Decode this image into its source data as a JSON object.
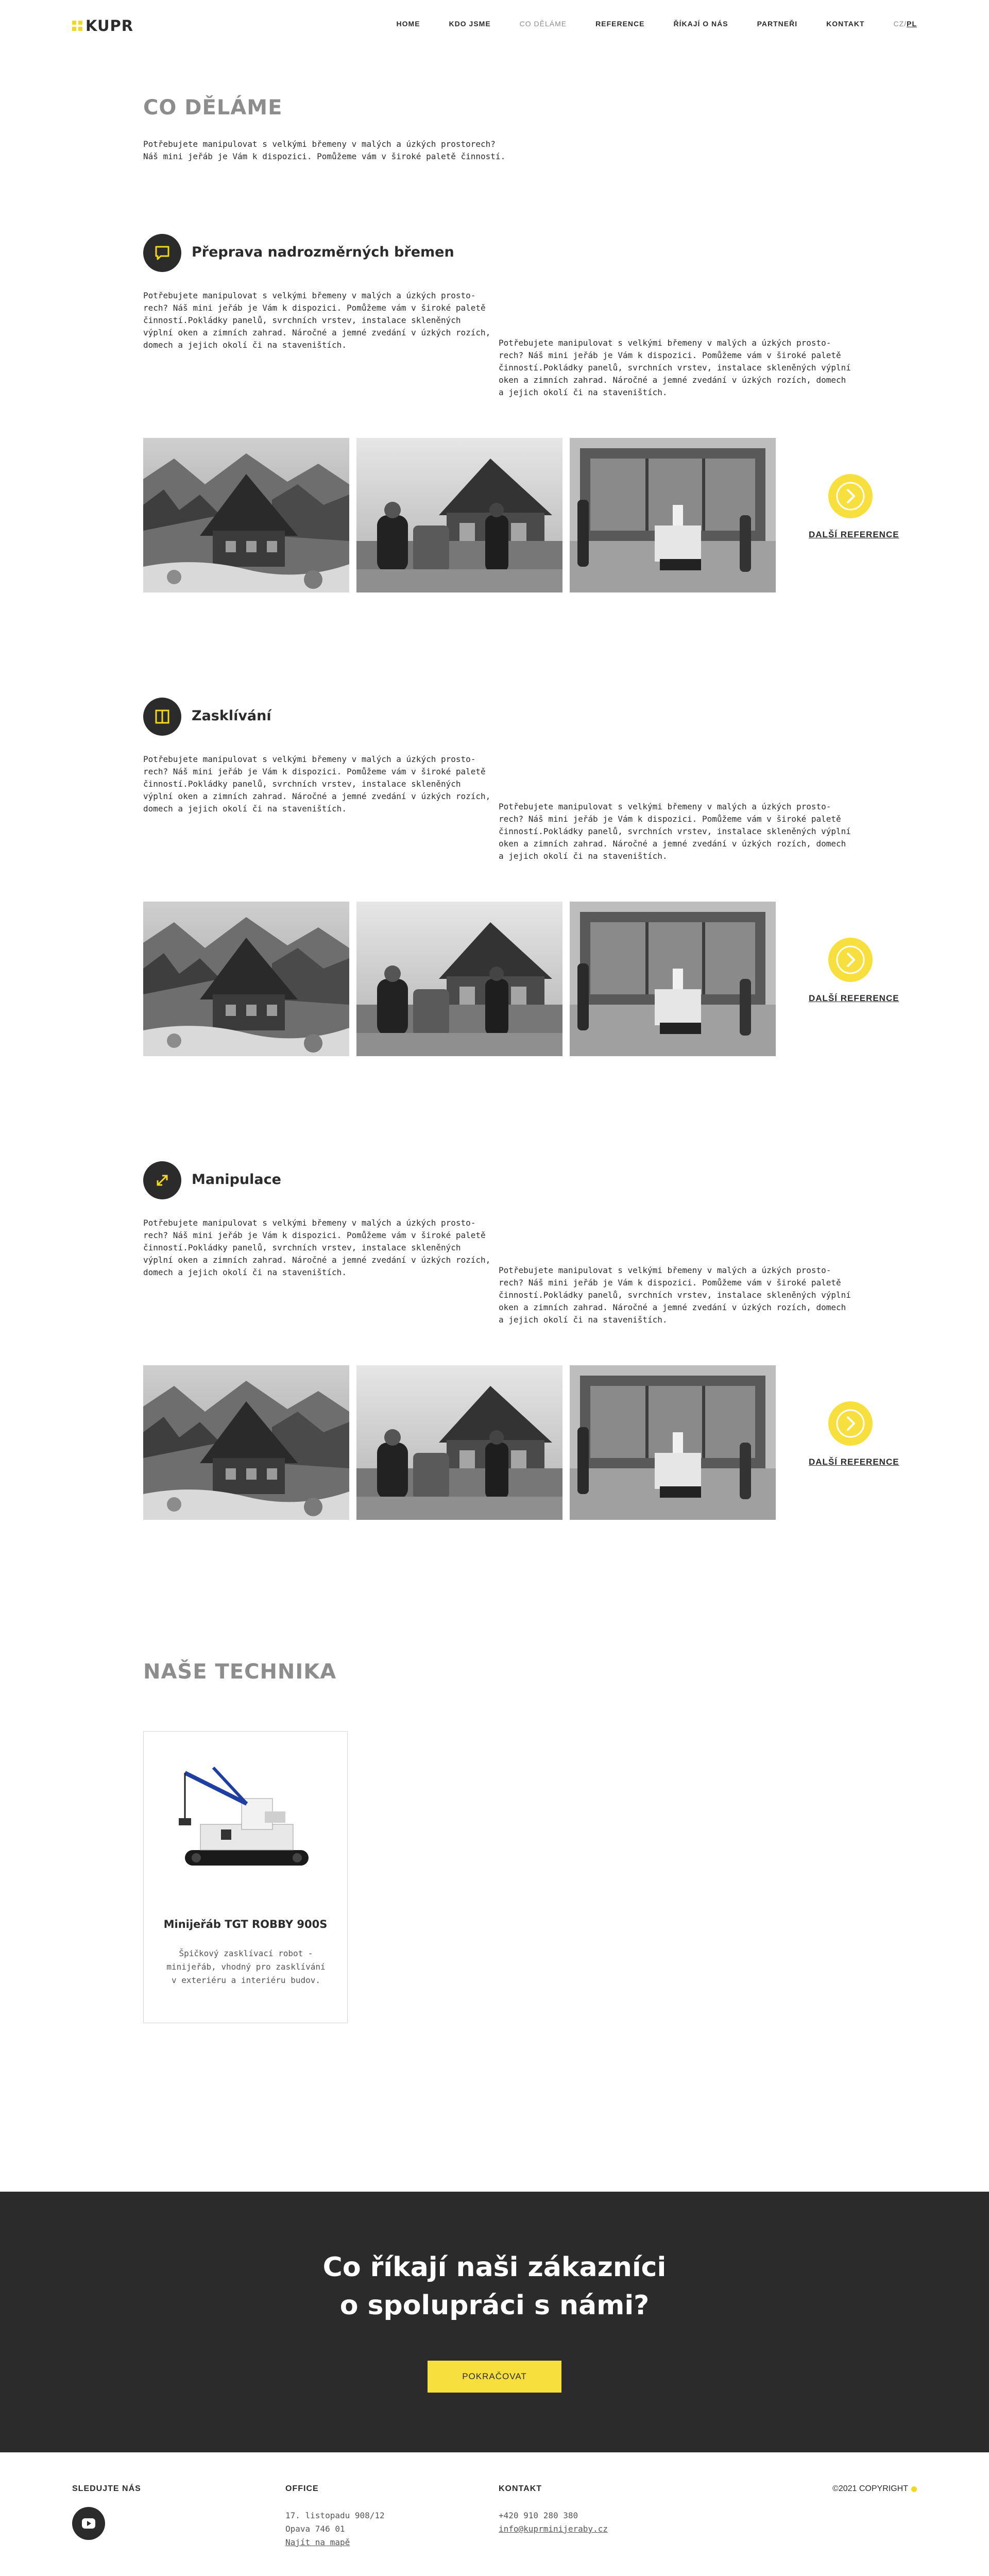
{
  "brand": {
    "name": "KUPR",
    "accent": "#f2d91f",
    "dark": "#2b2b2b"
  },
  "nav": {
    "items": [
      {
        "label": "HOME",
        "active": false
      },
      {
        "label": "KDO JSME",
        "active": false
      },
      {
        "label": "CO DĚLÁME",
        "active": true
      },
      {
        "label": "REFERENCE",
        "active": false
      },
      {
        "label": "ŘÍKAJÍ O NÁS",
        "active": false
      },
      {
        "label": "PARTNEŘI",
        "active": false
      },
      {
        "label": "KONTAKT",
        "active": false
      }
    ],
    "lang_cz": "CZ",
    "lang_sep": "/",
    "lang_pl": "PL"
  },
  "page": {
    "title": "CO DĚLÁME",
    "intro": "Potřebujete manipulovat s velkými břemeny v malých a úzkých prostorech? Náš mini jeřáb je Vám k dispozici. Pomůžeme vám v široké paletě činností."
  },
  "services": [
    {
      "title": "Přeprava nadrozměrných břemen",
      "icon": "chat-square-icon",
      "text_left": "Potřebujete manipulovat s velkými břemeny v malých a úzkých prosto-rech? Náš mini jeřáb je Vám k dispozici. Pomůžeme vám v široké paletě činností.Pokládky panelů, svrchních vrstev, instalace skleněných výplní oken a zimních zahrad. Náročné a jemné zvedání v úzkých rozích, domech a jejich okolí či na staveništích.",
      "text_right": "Potřebujete manipulovat s velkými břemeny v malých a úzkých prosto-rech? Náš mini jeřáb je Vám k dispozici. Pomůžeme vám v široké paletě činností.Pokládky panelů, svrchních vrstev, instalace skleněných výplní oken a zimních zahrad. Náročné a jemné zvedání v úzkých rozích, domech a jejich okolí či na staveništích.",
      "more_label": "DALŠÍ REFERENCE"
    },
    {
      "title": "Zasklívání",
      "icon": "window-icon",
      "text_left": "Potřebujete manipulovat s velkými břemeny v malých a úzkých prosto-rech? Náš mini jeřáb je Vám k dispozici. Pomůžeme vám v široké paletě činností.Pokládky panelů, svrchních vrstev, instalace skleněných výplní oken a zimních zahrad. Náročné a jemné zvedání v úzkých rozích, domech a jejich okolí či na staveništích.",
      "text_right": "Potřebujete manipulovat s velkými břemeny v malých a úzkých prosto-rech? Náš mini jeřáb je Vám k dispozici. Pomůžeme vám v široké paletě činností.Pokládky panelů, svrchních vrstev, instalace skleněných výplní oken a zimních zahrad. Náročné a jemné zvedání v úzkých rozích, domech a jejich okolí či na staveništích.",
      "more_label": "DALŠÍ REFERENCE"
    },
    {
      "title": "Manipulace",
      "icon": "expand-arrows-icon",
      "text_left": "Potřebujete manipulovat s velkými břemeny v malých a úzkých prosto-rech? Náš mini jeřáb je Vám k dispozici. Pomůžeme vám v široké paletě činností.Pokládky panelů, svrchních vrstev, instalace skleněných výplní oken a zimních zahrad. Náročné a jemné zvedání v úzkých rozích, domech a jejich okolí či na staveništích.",
      "text_right": "Potřebujete manipulovat s velkými břemeny v malých a úzkých prosto-rech? Náš mini jeřáb je Vám k dispozici. Pomůžeme vám v široké paletě činností.Pokládky panelů, svrchních vrstev, instalace skleněných výplní oken a zimních zahrad. Náročné a jemné zvedání v úzkých rozích, domech a jejich okolí či na staveništích.",
      "more_label": "DALŠÍ REFERENCE"
    }
  ],
  "technika": {
    "title": "NAŠE TECHNIKA",
    "card": {
      "name": "Minijeřáb TGT ROBBY 900S",
      "desc": "Špičkový zasklívací robot - minijeřáb, vhodný pro zasklívání v exteriéru a interiéru budov."
    }
  },
  "testimonials": {
    "title_line1": "Co říkají naši zákazníci",
    "title_line2": "o spolupráci s námi?",
    "button": "POKRAČOVAT"
  },
  "footer": {
    "follow": "SLEDUJTE NÁS",
    "office_head": "OFFICE",
    "office_line1": "17. listopadu 908/12",
    "office_line2": "Opava 746 01",
    "office_map": "Najít na mapě",
    "contact_head": "KONTAKT",
    "phone": "+420 910 280 380",
    "email": "info@kuprminijeraby.cz",
    "copyright": "©2021 COPYRIGHT"
  }
}
